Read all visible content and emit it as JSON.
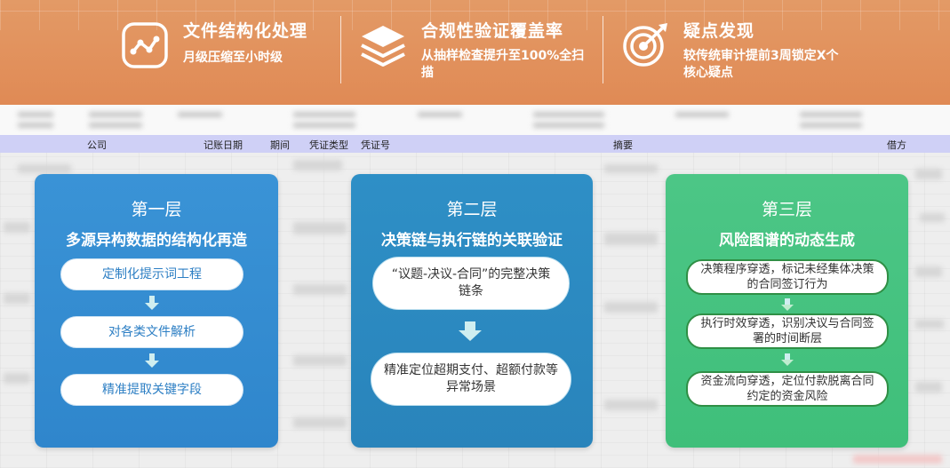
{
  "banner": {
    "features": [
      {
        "title": "文件结构化处理",
        "desc": "月级压缩至小时级",
        "icon": "chart-line-icon"
      },
      {
        "title": "合规性验证覆盖率",
        "desc": "从抽样检查提升至100%全扫描",
        "icon": "layers-icon"
      },
      {
        "title": "疑点发现",
        "desc": "较传统审计提前3周锁定X个核心疑点",
        "icon": "target-icon"
      }
    ],
    "color": "#e08a55"
  },
  "table_header": {
    "company": "公司",
    "posting_date": "记账日期",
    "period": "期间",
    "voucher_type": "凭证类型",
    "voucher_no": "凭证号",
    "summary": "摘要",
    "debit": "借方"
  },
  "layers": [
    {
      "name": "第一层",
      "title": "多源异构数据的结构化再造",
      "steps": [
        "定制化提示词工程",
        "对各类文件解析",
        "精准提取关键字段"
      ],
      "color": "#3a93d6"
    },
    {
      "name": "第二层",
      "title": "决策链与执行链的关联验证",
      "steps": [
        "“议题-决议-合同”的完整决策链条",
        "精准定位超期支付、超额付款等异常场景"
      ],
      "color": "#2e8fc6"
    },
    {
      "name": "第三层",
      "title": "风险图谱的动态生成",
      "steps": [
        "决策程序穿透，标记未经集体决策的合同签订行为",
        "执行时效穿透，识别决议与合同签署的时间断层",
        "资金流向穿透，定位付款脱离合同约定的资金风险"
      ],
      "color": "#4cc686"
    }
  ]
}
